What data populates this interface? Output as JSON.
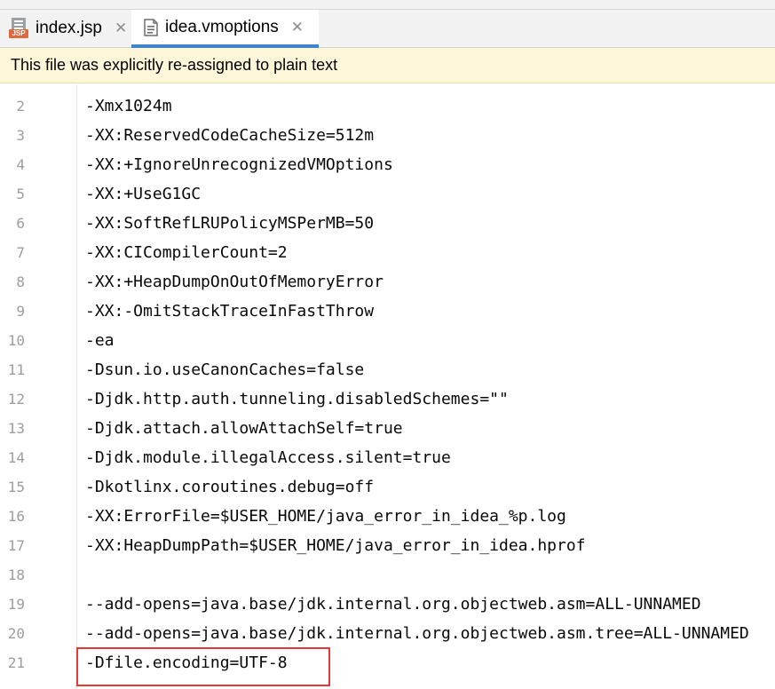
{
  "tabs": [
    {
      "label": "index.jsp",
      "icon": "jsp-file-icon",
      "active": false
    },
    {
      "label": "idea.vmoptions",
      "icon": "text-file-icon",
      "active": true
    }
  ],
  "tab_icons": {
    "jsp_badge": "JSP"
  },
  "notice": {
    "text": "This file was explicitly re-assigned to plain text"
  },
  "editor": {
    "lines": [
      {
        "number": "2",
        "text": "-Xmx1024m"
      },
      {
        "number": "3",
        "text": "-XX:ReservedCodeCacheSize=512m"
      },
      {
        "number": "4",
        "text": "-XX:+IgnoreUnrecognizedVMOptions"
      },
      {
        "number": "5",
        "text": "-XX:+UseG1GC"
      },
      {
        "number": "6",
        "text": "-XX:SoftRefLRUPolicyMSPerMB=50"
      },
      {
        "number": "7",
        "text": "-XX:CICompilerCount=2"
      },
      {
        "number": "8",
        "text": "-XX:+HeapDumpOnOutOfMemoryError"
      },
      {
        "number": "9",
        "text": "-XX:-OmitStackTraceInFastThrow"
      },
      {
        "number": "10",
        "text": "-ea"
      },
      {
        "number": "11",
        "text": "-Dsun.io.useCanonCaches=false"
      },
      {
        "number": "12",
        "text": "-Djdk.http.auth.tunneling.disabledSchemes=\"\""
      },
      {
        "number": "13",
        "text": "-Djdk.attach.allowAttachSelf=true"
      },
      {
        "number": "14",
        "text": "-Djdk.module.illegalAccess.silent=true"
      },
      {
        "number": "15",
        "text": "-Dkotlinx.coroutines.debug=off"
      },
      {
        "number": "16",
        "text": "-XX:ErrorFile=$USER_HOME/java_error_in_idea_%p.log"
      },
      {
        "number": "17",
        "text": "-XX:HeapDumpPath=$USER_HOME/java_error_in_idea.hprof"
      },
      {
        "number": "18",
        "text": ""
      },
      {
        "number": "19",
        "text": "--add-opens=java.base/jdk.internal.org.objectweb.asm=ALL-UNNAMED"
      },
      {
        "number": "20",
        "text": "--add-opens=java.base/jdk.internal.org.objectweb.asm.tree=ALL-UNNAMED"
      },
      {
        "number": "21",
        "text": "-Dfile.encoding=UTF-8"
      }
    ]
  },
  "colors": {
    "active_tab_underline": "#4083c9",
    "notice_background": "#fdf6d8",
    "highlight_box": "#e53935",
    "line_number": "#9d9d9d"
  }
}
